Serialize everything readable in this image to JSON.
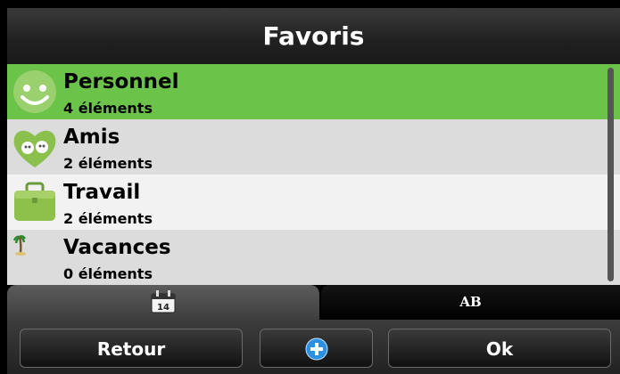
{
  "header": {
    "title": "Favoris"
  },
  "list": {
    "items": [
      {
        "title": "Personnel",
        "subtitle": "4 éléments",
        "icon": "smiley-icon",
        "selected": true,
        "bg": "#6cc34a"
      },
      {
        "title": "Amis",
        "subtitle": "2 éléments",
        "icon": "friends-heart-icon",
        "selected": false,
        "bg": "#dcdcdc"
      },
      {
        "title": "Travail",
        "subtitle": "2 éléments",
        "icon": "briefcase-icon",
        "selected": false,
        "bg": "#f2f2f2"
      },
      {
        "title": "Vacances",
        "subtitle": "0 éléments",
        "icon": "palm-tree-icon",
        "selected": false,
        "bg": "#dcdcdc"
      }
    ]
  },
  "tabs": {
    "calendar": {
      "icon": "calendar-icon",
      "day": "14"
    },
    "ab": {
      "label": "AB"
    }
  },
  "buttons": {
    "back": "Retour",
    "add_icon": "plus-circle-icon",
    "ok": "Ok"
  },
  "colors": {
    "accent": "#6cc34a",
    "row_dark": "#dcdcdc",
    "row_light": "#f2f2f2",
    "add_blue": "#2d8fe0"
  }
}
